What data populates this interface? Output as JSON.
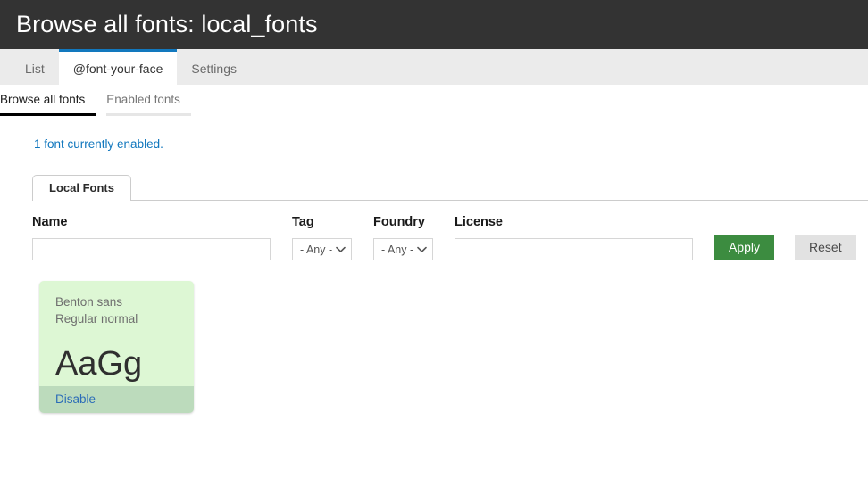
{
  "header": {
    "title": "Browse all fonts: local_fonts"
  },
  "primary_tabs": [
    {
      "label": "List",
      "active": false
    },
    {
      "label": "@font-your-face",
      "active": true
    },
    {
      "label": "Settings",
      "active": false
    }
  ],
  "secondary_tabs": [
    {
      "label": "Browse all fonts",
      "active": true
    },
    {
      "label": "Enabled fonts",
      "active": false
    }
  ],
  "status": {
    "message": "1 font currently enabled."
  },
  "group_tabs": [
    {
      "label": "Local Fonts",
      "active": true
    }
  ],
  "filter_form": {
    "name": {
      "label": "Name",
      "value": "",
      "placeholder": ""
    },
    "tag": {
      "label": "Tag",
      "selected": "- Any -",
      "options": [
        "- Any -"
      ]
    },
    "foundry": {
      "label": "Foundry",
      "selected": "- Any -",
      "options": [
        "- Any -"
      ]
    },
    "license": {
      "label": "License",
      "value": "",
      "placeholder": ""
    },
    "apply_label": "Apply",
    "reset_label": "Reset"
  },
  "fonts": [
    {
      "name": "Benton sans",
      "variant": "Regular normal",
      "sample": "AaGg",
      "action_label": "Disable",
      "enabled": true
    }
  ],
  "colors": {
    "header_bg": "#333333",
    "tabbar_bg": "#ebebeb",
    "active_tab_accent": "#1278be",
    "link": "#0f76bd",
    "apply_green": "#3c8c40",
    "reset_gray": "#e2e2e2",
    "card_bg": "#ddf7d4",
    "card_footer_bg": "#bcdbbc"
  }
}
